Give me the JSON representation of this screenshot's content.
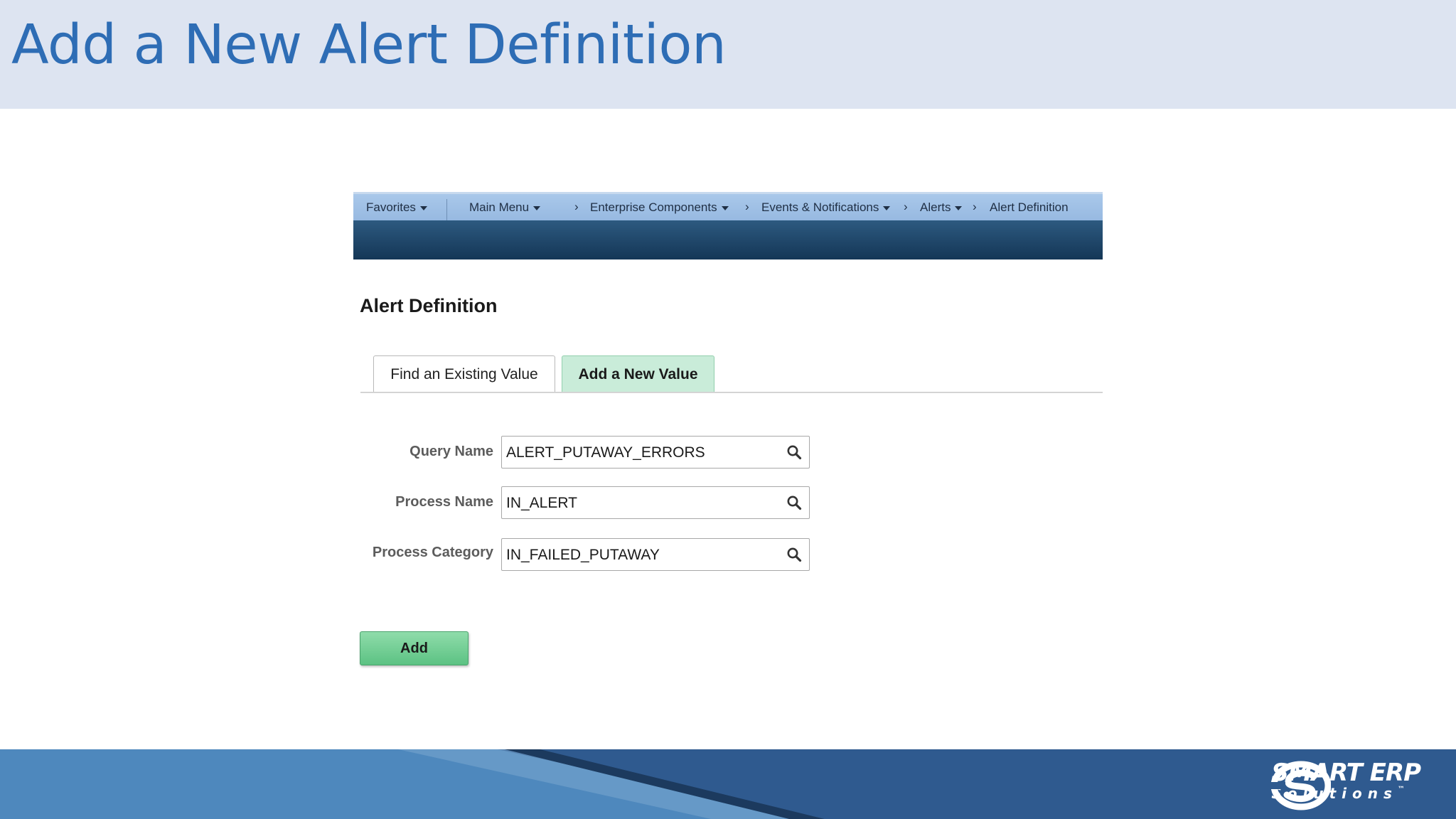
{
  "slide": {
    "title": "Add a New Alert Definition"
  },
  "navbar": {
    "favorites": "Favorites",
    "main_menu": "Main Menu",
    "breadcrumbs": [
      "Enterprise Components",
      "Events & Notifications",
      "Alerts",
      "Alert Definition"
    ]
  },
  "page": {
    "heading": "Alert Definition",
    "tabs": [
      {
        "label": "Find an Existing Value",
        "active": false
      },
      {
        "label": "Add a New Value",
        "active": true
      }
    ],
    "fields": [
      {
        "label": "Query Name",
        "value": "ALERT_PUTAWAY_ERRORS",
        "icon": "search-icon"
      },
      {
        "label": "Process Name",
        "value": "IN_ALERT",
        "icon": "search-icon"
      },
      {
        "label": "Process Category",
        "value": "IN_FAILED_PUTAWAY",
        "icon": "search-icon"
      }
    ],
    "add_button": "Add"
  },
  "footer": {
    "logo_main": "SMART ERP",
    "logo_sub": "Solutions",
    "logo_mark": "™"
  },
  "colors": {
    "title": "#2e6db5",
    "title_band": "#dde4f1",
    "nav_top": "#a9c8ea",
    "nav_bottom": "#143656",
    "active_tab": "#c9ecd9",
    "add_button": "#5cc283",
    "footer": "#2f5a8f"
  }
}
